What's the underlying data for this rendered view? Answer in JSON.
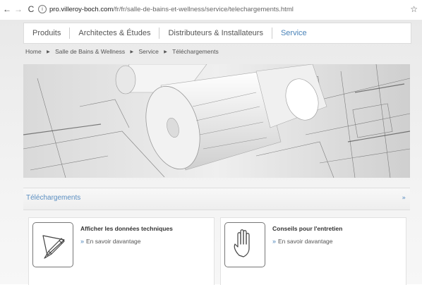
{
  "browser": {
    "back": "←",
    "forward": "→",
    "reload": "C",
    "url_domain": "pro.villeroy-boch.com",
    "url_path": "/fr/fr/salle-de-bains-et-wellness/service/telechargements.html",
    "info_icon": "i",
    "star": "☆"
  },
  "nav": {
    "items": [
      {
        "label": "Produits"
      },
      {
        "label": "Architectes & Études"
      },
      {
        "label": "Distributeurs & Installateurs"
      },
      {
        "label": "Service",
        "active": true
      }
    ]
  },
  "breadcrumb": {
    "separator": "▶",
    "items": [
      "Home",
      "Salle de Bains & Wellness",
      "Service",
      "Téléchargements"
    ]
  },
  "downloads": {
    "title": "Téléchargements",
    "chevron": "»"
  },
  "cards": [
    {
      "title": "Afficher les données techniques",
      "link": "En savoir davantage",
      "icon": "drafting-pen-icon"
    },
    {
      "title": "Conseils pour l'entretien",
      "link": "En savoir davantage",
      "icon": "hand-icon"
    }
  ],
  "link_arrow": "»",
  "colors": {
    "accent": "#4a83b8",
    "text": "#555555"
  }
}
